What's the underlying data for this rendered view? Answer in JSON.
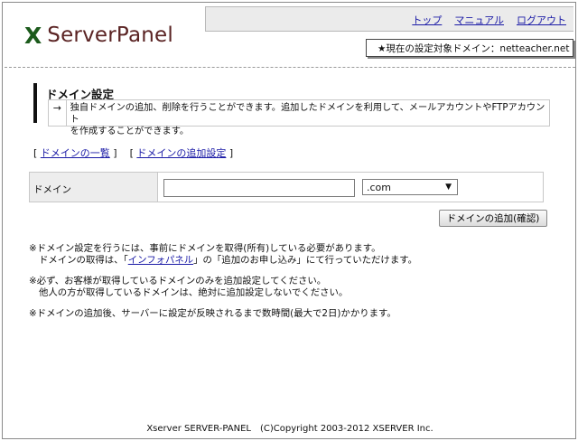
{
  "header": {
    "logo_mark": "X",
    "logo_text": "ServerPanel",
    "links": [
      "トップ",
      "マニュアル",
      "ログアウト"
    ],
    "current_domain_label": "★現在の設定対象ドメイン：netteacher.net"
  },
  "section": {
    "title": "ドメイン設定",
    "arrow": "→",
    "description_line1": "独自ドメインの追加、削除を行うことができます。追加したドメインを利用して、メールアカウントやFTPアカウント",
    "description_line2": "を作成することができます。"
  },
  "sublinks": {
    "list": "ドメインの一覧",
    "add": "ドメインの追加設定"
  },
  "form": {
    "label": "ドメイン",
    "input_value": "",
    "tld_selected": ".com",
    "submit_label": "ドメインの追加(確認)"
  },
  "notes": {
    "n1_line1": "※ドメイン設定を行うには、事前にドメインを取得(所有)している必要があります。",
    "n1_line2_pre": "ドメインの取得は、「",
    "n1_link": "インフォパネル",
    "n1_line2_post": "」の「追加のお申し込み」にて行っていただけます。",
    "n2_line1": "※必ず、お客様が取得しているドメインのみを追加設定してください。",
    "n2_line2": "他人の方が取得しているドメインは、絶対に追加設定しないでください。",
    "n3_line1": "※ドメインの追加後、サーバーに設定が反映されるまで数時間(最大で2日)かかります。"
  },
  "footer": "Xserver SERVER-PANEL　(C)Copyright 2003-2012 XSERVER Inc."
}
